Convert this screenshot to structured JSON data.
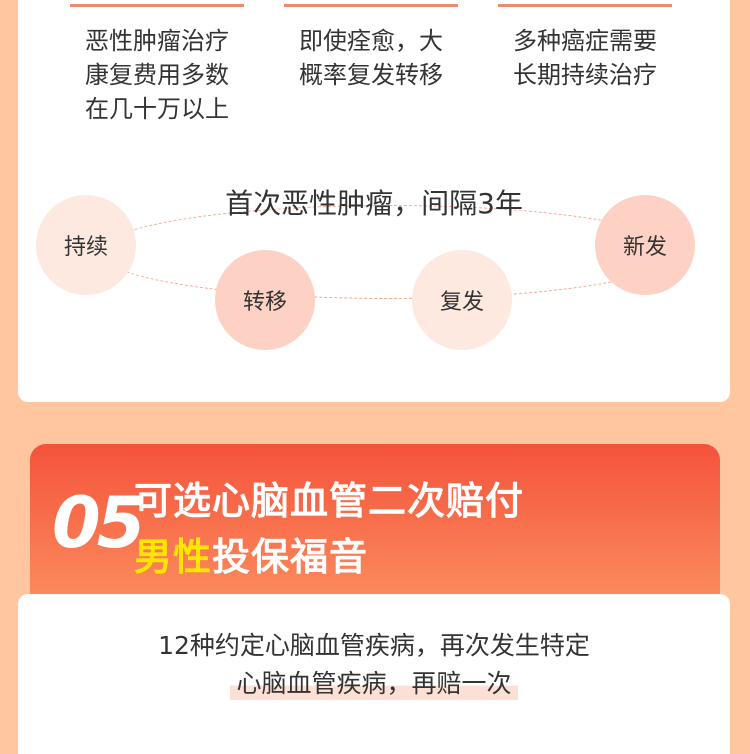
{
  "top_columns": [
    {
      "lines": [
        "恶性肿瘤治疗",
        "康复费用多数",
        "在几十万以上"
      ]
    },
    {
      "lines": [
        "即使痊愈，大",
        "概率复发转移"
      ]
    },
    {
      "lines": [
        "多种癌症需要",
        "长期持续治疗"
      ]
    }
  ],
  "cycle": {
    "title": "首次恶性肿瘤，间隔3年",
    "nodes": [
      "持续",
      "转移",
      "复发",
      "新发"
    ]
  },
  "section05": {
    "number": "05",
    "line1": "可选心脑血管二次赔付",
    "line2_highlight": "男性",
    "line2_rest": "投保福音"
  },
  "description": {
    "line1": "12种约定心脑血管疾病，再次发生特定",
    "line2": "心脑血管疾病，再赔一次"
  },
  "colors": {
    "background": "#ffc6a0",
    "accent_red": "#f4533b",
    "highlight_yellow": "#ffe600"
  }
}
